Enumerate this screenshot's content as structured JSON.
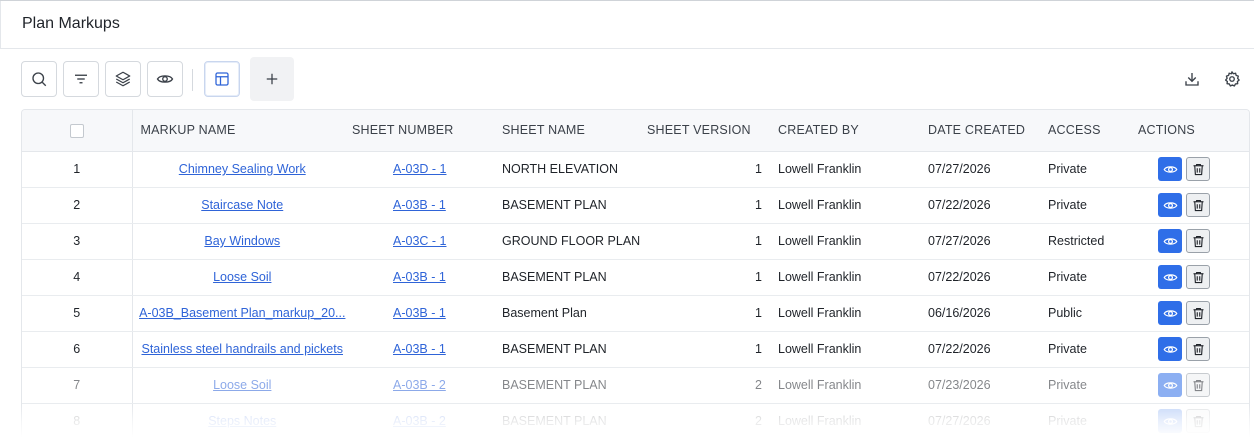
{
  "page": {
    "title": "Plan Markups"
  },
  "toolbar": {
    "buttons": [
      {
        "name": "search-button",
        "icon": "search-icon"
      },
      {
        "name": "filter-button",
        "icon": "filter-icon"
      },
      {
        "name": "layers-button",
        "icon": "layers-icon"
      },
      {
        "name": "visibility-button",
        "icon": "eye-icon"
      },
      {
        "name": "table-view-button",
        "icon": "table-icon",
        "active": true
      },
      {
        "name": "add-button",
        "icon": "plus-icon"
      }
    ],
    "right_icons": [
      "download-icon",
      "settings-icon"
    ]
  },
  "table": {
    "headers": {
      "markup_name": "MARKUP NAME",
      "sheet_number": "SHEET NUMBER",
      "sheet_name": "SHEET NAME",
      "sheet_version": "SHEET VERSION",
      "created_by": "CREATED BY",
      "date_created": "DATE CREATED",
      "access": "ACCESS",
      "actions": "ACTIONS"
    },
    "rows": [
      {
        "num": "1",
        "markup_name": "Chimney Sealing Work",
        "sheet_number": "A-03D - 1",
        "sheet_name": "NORTH ELEVATION",
        "sheet_version": "1",
        "created_by": "Lowell Franklin",
        "date_created": "07/27/2026",
        "access": "Private"
      },
      {
        "num": "2",
        "markup_name": "Staircase Note",
        "sheet_number": "A-03B - 1",
        "sheet_name": "BASEMENT PLAN",
        "sheet_version": "1",
        "created_by": "Lowell Franklin",
        "date_created": "07/22/2026",
        "access": "Private"
      },
      {
        "num": "3",
        "markup_name": "Bay Windows",
        "sheet_number": "A-03C - 1",
        "sheet_name": "GROUND FLOOR PLAN",
        "sheet_version": "1",
        "created_by": "Lowell Franklin",
        "date_created": "07/27/2026",
        "access": "Restricted"
      },
      {
        "num": "4",
        "markup_name": "Loose Soil",
        "sheet_number": "A-03B - 1",
        "sheet_name": "BASEMENT PLAN",
        "sheet_version": "1",
        "created_by": "Lowell Franklin",
        "date_created": "07/22/2026",
        "access": "Private"
      },
      {
        "num": "5",
        "markup_name": "A-03B_Basement Plan_markup_20...",
        "sheet_number": "A-03B - 1",
        "sheet_name": "Basement Plan",
        "sheet_version": "1",
        "created_by": "Lowell Franklin",
        "date_created": "06/16/2026",
        "access": "Public"
      },
      {
        "num": "6",
        "markup_name": "Stainless steel handrails and pickets",
        "sheet_number": "A-03B - 1",
        "sheet_name": "BASEMENT PLAN",
        "sheet_version": "1",
        "created_by": "Lowell Franklin",
        "date_created": "07/22/2026",
        "access": "Private"
      },
      {
        "num": "7",
        "markup_name": "Loose Soil",
        "sheet_number": "A-03B - 2",
        "sheet_name": "BASEMENT PLAN",
        "sheet_version": "2",
        "created_by": "Lowell Franklin",
        "date_created": "07/23/2026",
        "access": "Private"
      },
      {
        "num": "8",
        "markup_name": "Steps Notes",
        "sheet_number": "A-03B - 2",
        "sheet_name": "BASEMENT PLAN",
        "sheet_version": "2",
        "created_by": "Lowell Franklin",
        "date_created": "07/27/2026",
        "access": "Private"
      }
    ]
  },
  "colors": {
    "link": "#2f64d8",
    "view_button": "#2f6ee8",
    "header_bg": "#f7f8fa"
  }
}
